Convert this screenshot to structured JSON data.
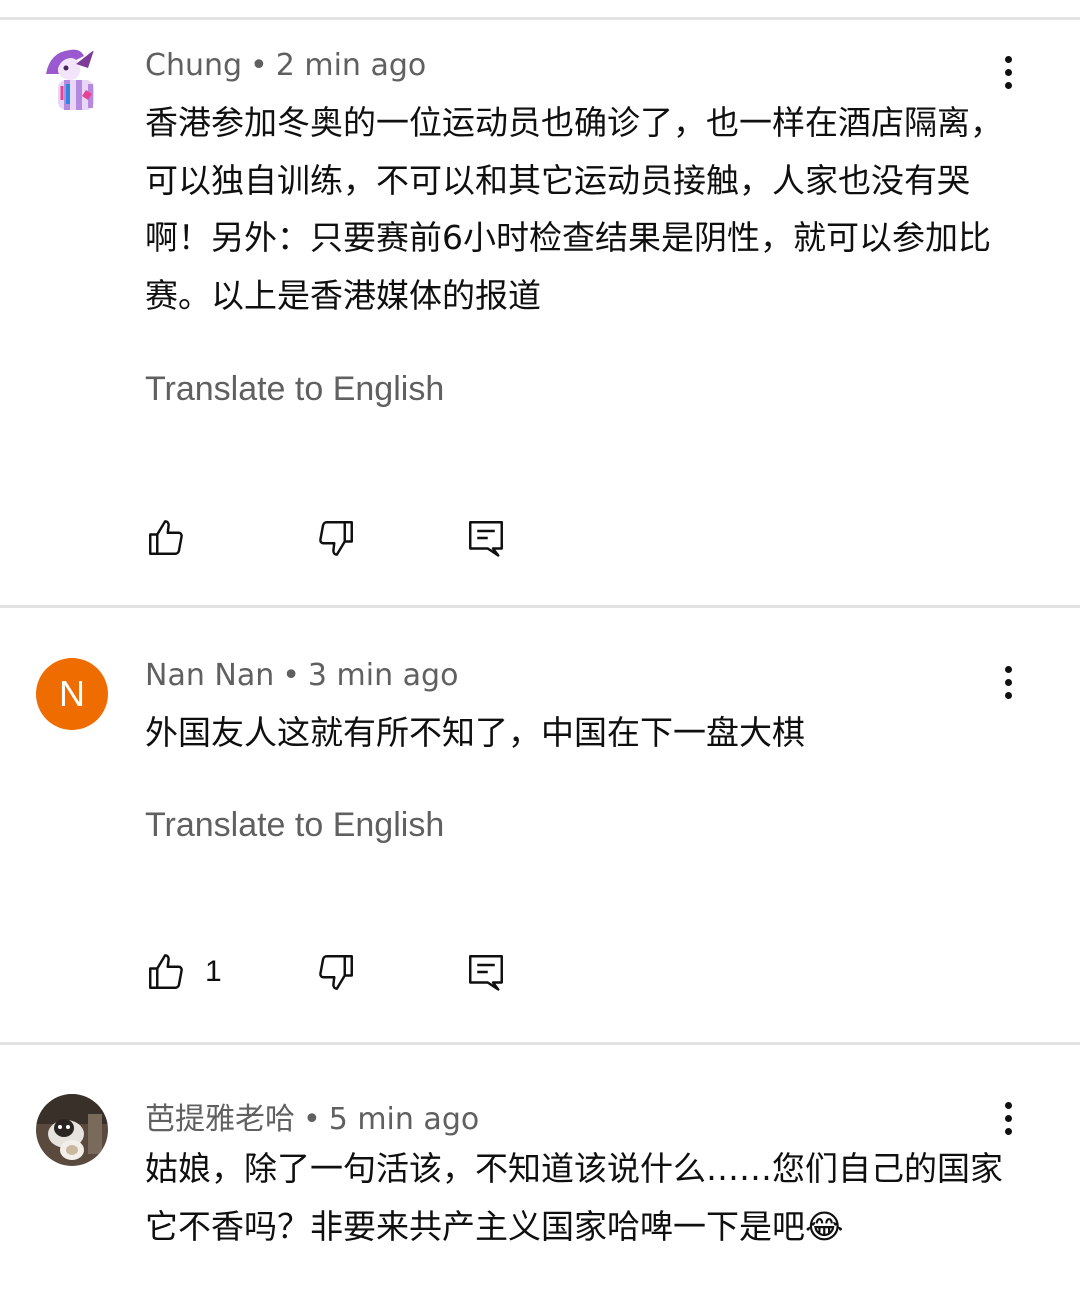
{
  "comments": [
    {
      "author": "Chung",
      "time": "2 min ago",
      "text": "香港参加冬奥的一位运动员也确诊了，也一样在酒店隔离，可以独自训练，不可以和其它运动员接触，人家也没有哭啊！另外：只要赛前6小时检查结果是阴性，就可以参加比赛。以上是香港媒体的报道",
      "translate": "Translate to English",
      "like_count": ""
    },
    {
      "author": "Nan Nan",
      "avatar_letter": "N",
      "time": "3 min ago",
      "text": "外国友人这就有所不知了，中国在下一盘大棋",
      "translate": "Translate to English",
      "like_count": "1"
    },
    {
      "author": "芭提雅老哈",
      "time": "5 min ago",
      "text": "姑娘，除了一句活该，不知道该说什么……您们自己的国家它不香吗？非要来共产主义国家哈啤一下是吧😂"
    }
  ],
  "colors": {
    "avatar_n": "#ef6c00",
    "meta": "#606060",
    "divider": "#e3e3e3"
  },
  "icons": [
    "thumb-up-icon",
    "thumb-down-icon",
    "reply-icon",
    "more-vert-icon"
  ]
}
